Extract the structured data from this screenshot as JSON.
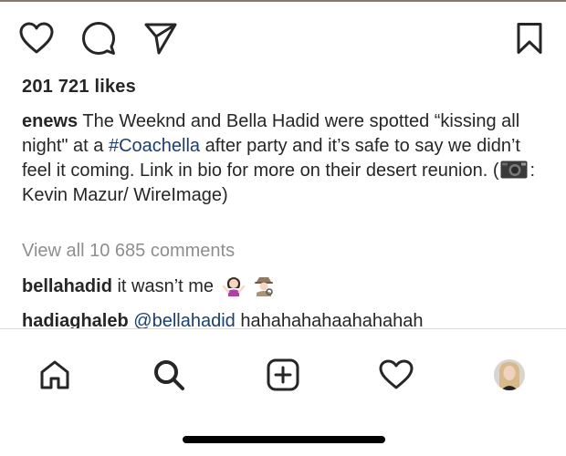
{
  "post": {
    "likes": "201 721 likes",
    "caption": {
      "user": "enews",
      "text_part1": " The Weeknd and Bella Hadid were spotted “kissing all night\" at a ",
      "hashtag": "#Coachella",
      "text_part2": " after party and it’s safe to say we didn’t feel it coming. Link in bio for more on their desert reunion. (",
      "text_part3": ": Kevin Mazur/ WireImage)"
    },
    "view_all_comments": "View all 10 685 comments",
    "comments": [
      {
        "user": "bellahadid",
        "text": "it wasn’t me",
        "emojis": [
          "woman-shrugging-icon",
          "detective-icon"
        ]
      },
      {
        "user": "hadiaghaleb",
        "mention": "@bellahadid",
        "text": " hahahahahaahahahah"
      }
    ]
  },
  "icons": {
    "actions": [
      "heart-icon",
      "comment-icon",
      "share-icon",
      "bookmark-icon"
    ],
    "tabs": [
      "home-icon",
      "search-icon",
      "add-post-icon",
      "activity-icon",
      "profile-avatar"
    ]
  },
  "colors": {
    "text": "#262626",
    "hashtag": "#1b3f71",
    "muted": "#8e8e8e"
  }
}
